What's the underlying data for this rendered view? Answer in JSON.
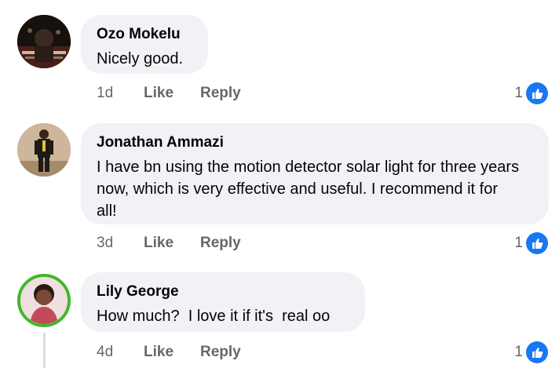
{
  "comments": [
    {
      "author": "Ozo Mokelu",
      "text": "Nicely good.",
      "age": "1d",
      "like_label": "Like",
      "reply_label": "Reply",
      "reaction_count": "1",
      "reaction_icon": "thumbs-up-icon"
    },
    {
      "author": "Jonathan Ammazi",
      "text": "I have bn using the motion detector solar light for three years now, which is very effective and useful. I recommend it for all!",
      "age": "3d",
      "like_label": "Like",
      "reply_label": "Reply",
      "reaction_count": "1",
      "reaction_icon": "thumbs-up-icon"
    },
    {
      "author": "Lily George",
      "text": "How much?  I love it if it's  real oo",
      "age": "4d",
      "like_label": "Like",
      "reply_label": "Reply",
      "reaction_count": "1",
      "reaction_icon": "thumbs-up-icon"
    }
  ],
  "colors": {
    "bubble": "#f0f2f5",
    "meta_text": "#65676b",
    "like_blue": "#1877f2",
    "active_ring": "#42b72a"
  }
}
